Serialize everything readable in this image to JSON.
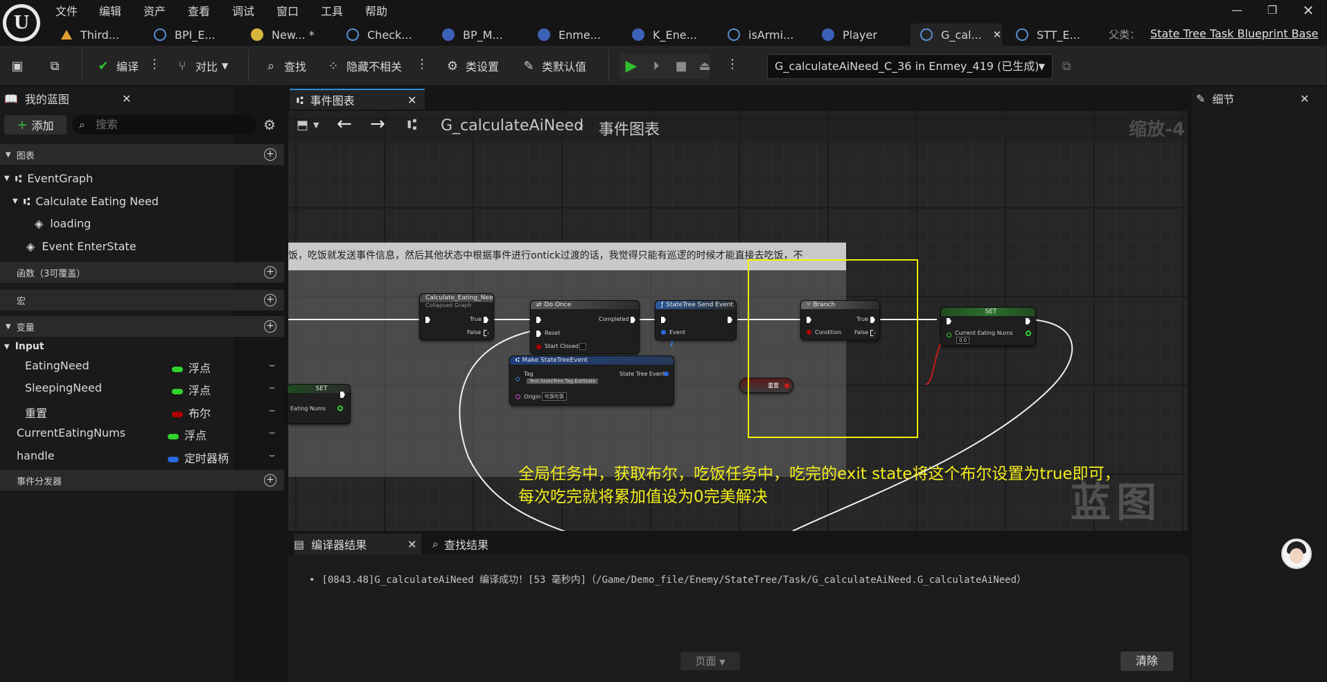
{
  "menu": [
    "文件",
    "编辑",
    "资产",
    "查看",
    "调试",
    "窗口",
    "工具",
    "帮助"
  ],
  "tabs": [
    {
      "label": "Third...",
      "color": "#e0a030"
    },
    {
      "label": "BPI_E...",
      "color": "#5b8fd6"
    },
    {
      "label": "New...  *",
      "color": "#d6b53c"
    },
    {
      "label": "Check...",
      "color": "#5b8fd6"
    },
    {
      "label": "BP_M...",
      "color": "#5b8fd6"
    },
    {
      "label": "Enme...",
      "color": "#5b8fd6"
    },
    {
      "label": "K_Ene...",
      "color": "#5b8fd6"
    },
    {
      "label": "isArmi...",
      "color": "#5b8fd6"
    },
    {
      "label": "Player",
      "color": "#5b8fd6"
    },
    {
      "label": "G_cal...",
      "color": "#5b8fd6"
    },
    {
      "label": "STT_E...",
      "color": "#5b8fd6"
    }
  ],
  "parent": {
    "label": "父类：",
    "value": "State Tree Task Blueprint Base"
  },
  "toolbar": {
    "compile": "编译",
    "diff": "对比",
    "find": "查找",
    "hide_unrelated": "隐藏不相关",
    "class_settings": "类设置",
    "class_defaults": "类默认值",
    "debug_object": "G_calculateAiNeed_C_36 in Enmey_419 (已生成)"
  },
  "left_panel": {
    "tab_title": "我的蓝图",
    "add_label": "添加",
    "search_placeholder": "搜索",
    "sections": {
      "graphs": "图表",
      "functions": "函数（3可覆盖）",
      "macros": "宏",
      "variables": "变量",
      "dispatchers": "事件分发器"
    },
    "tree": {
      "event_graph": "EventGraph",
      "collapsed": "Calculate Eating Need",
      "loading": "loading",
      "enter_state": "Event EnterState"
    },
    "input_category": "Input",
    "variables": [
      {
        "name": "EatingNeed",
        "type": "浮点",
        "color": "#2ed32e"
      },
      {
        "name": "SleepingNeed",
        "type": "浮点",
        "color": "#2ed32e"
      },
      {
        "name": "重置",
        "type": "布尔",
        "color": "#b00000"
      },
      {
        "name": "CurrentEatingNums",
        "type": "浮点",
        "color": "#2ed32e"
      },
      {
        "name": "handle",
        "type": "定时器柄",
        "color": "#2a6ae0"
      }
    ]
  },
  "graph": {
    "tab_title": "事件图表",
    "breadcrumb_root": "G_calculateAiNeed",
    "breadcrumb_leaf": "事件图表",
    "zoom": "缩放-4",
    "comment_text": "饭，吃饭就发送事件信息，然后其他状态中根据事件进行ontick过渡的话，我觉得只能有巡逻的时候才能直接去吃饭，不",
    "nodes": {
      "calc_title": "Calculate_Eating_Need",
      "calc_sub": "Collapsed Graph",
      "true": "True",
      "false": "False",
      "do_once": "Do Once",
      "completed": "Completed",
      "reset": "Reset",
      "start_closed": "Start Closed",
      "send_event": "StateTree Send Event",
      "event": "Event",
      "make_event": "Make StateTreeEvent",
      "tag": "Tag",
      "tag_value": "Test.StateTree.Tag.EatState",
      "state_tree_event": "State Tree Event",
      "origin": "Origin",
      "origin_value": "吃饭吃饭",
      "branch": "Branch",
      "condition": "Condition",
      "set": "SET",
      "current_eating_nums": "Current Eating Nums",
      "set_value": "0.0",
      "left_set_pin": "Eating Nums",
      "reset_var": "重置"
    },
    "note_line1": "全局任务中，获取布尔，吃饭任务中，吃完的exit state将这个布尔设置为true即可，",
    "note_line2": "每次吃完就将累加值设为0完美解决",
    "watermark": "蓝图"
  },
  "bottom": {
    "compiler_tab": "编译器结果",
    "find_tab": "查找结果",
    "log_line": "[0843.48]G_calculateAiNeed 编译成功！[53 毫秒内]（/Game/Demo_file/Enemy/StateTree/Task/G_calculateAiNeed.G_calculateAiNeed）",
    "page_label": "页面",
    "clear_label": "清除"
  },
  "details": {
    "tab_title": "细节"
  }
}
